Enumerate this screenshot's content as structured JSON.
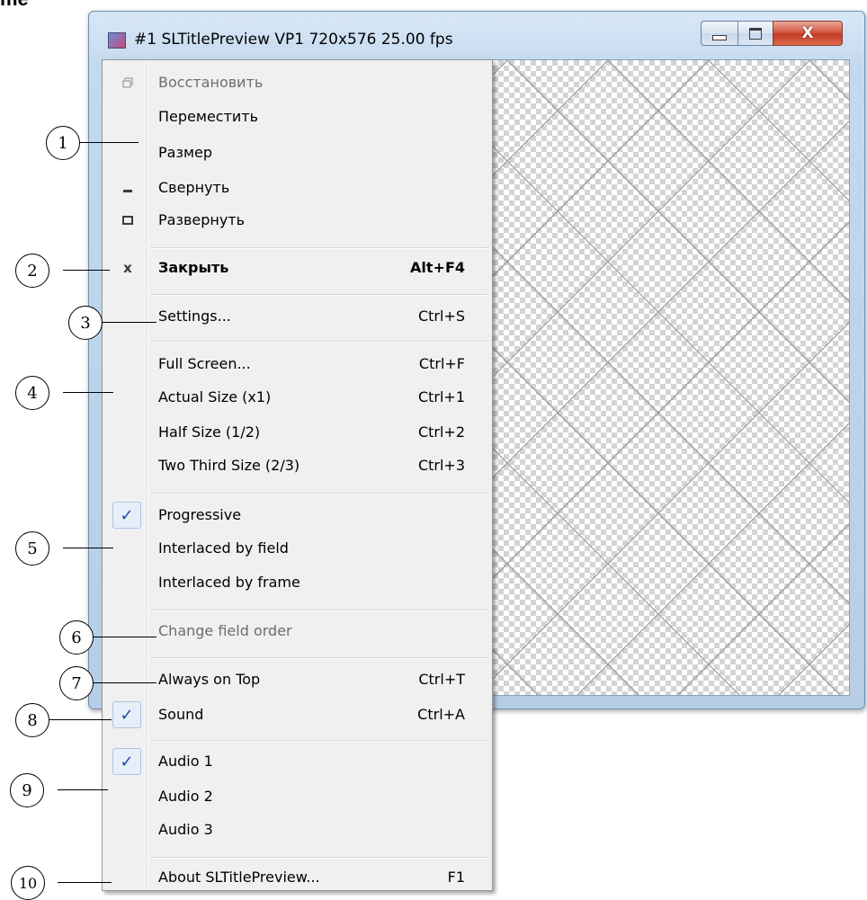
{
  "corner_fragment": "me",
  "window": {
    "title": "#1 SLTitlePreview VP1 720x576 25.00 fps",
    "icons": {
      "app": "app-icon",
      "minimize": "minimize-icon",
      "maximize": "maximize-icon",
      "close": "close-icon"
    },
    "close_glyph": "X"
  },
  "menu": {
    "items": [
      {
        "label": "Восстановить",
        "shortcut": "",
        "icon": "restore-icon",
        "disabled": true
      },
      {
        "label": "Переместить",
        "shortcut": ""
      },
      {
        "label": "Размер",
        "shortcut": ""
      },
      {
        "label": "Свернуть",
        "shortcut": "",
        "icon": "minimize-icon",
        "glyph": "▁"
      },
      {
        "label": "Развернуть",
        "shortcut": "",
        "icon": "maximize-icon",
        "glyph": "▣"
      },
      {
        "label": "Закрыть",
        "shortcut": "Alt+F4",
        "icon": "close-icon",
        "glyph": "x",
        "bold": true
      },
      {
        "label": "Settings...",
        "shortcut": "Ctrl+S"
      },
      {
        "label": "Full Screen...",
        "shortcut": "Ctrl+F"
      },
      {
        "label": "Actual Size (x1)",
        "shortcut": "Ctrl+1"
      },
      {
        "label": "Half Size (1/2)",
        "shortcut": "Ctrl+2"
      },
      {
        "label": "Two Third Size (2/3)",
        "shortcut": "Ctrl+3"
      },
      {
        "label": "Progressive",
        "shortcut": "",
        "checked": true
      },
      {
        "label": "Interlaced by field",
        "shortcut": ""
      },
      {
        "label": "Interlaced by frame",
        "shortcut": ""
      },
      {
        "label": "Change field order",
        "shortcut": "",
        "disabled": true
      },
      {
        "label": "Always on Top",
        "shortcut": "Ctrl+T"
      },
      {
        "label": "Sound",
        "shortcut": "Ctrl+A",
        "checked": true
      },
      {
        "label": "Audio 1",
        "shortcut": "",
        "checked": true
      },
      {
        "label": "Audio 2",
        "shortcut": ""
      },
      {
        "label": "Audio 3",
        "shortcut": ""
      },
      {
        "label": "About SLTitlePreview...",
        "shortcut": "F1"
      }
    ],
    "check_glyph": "✓"
  },
  "callouts": [
    "1",
    "2",
    "3",
    "4",
    "5",
    "6",
    "7",
    "8",
    "9",
    "10"
  ]
}
